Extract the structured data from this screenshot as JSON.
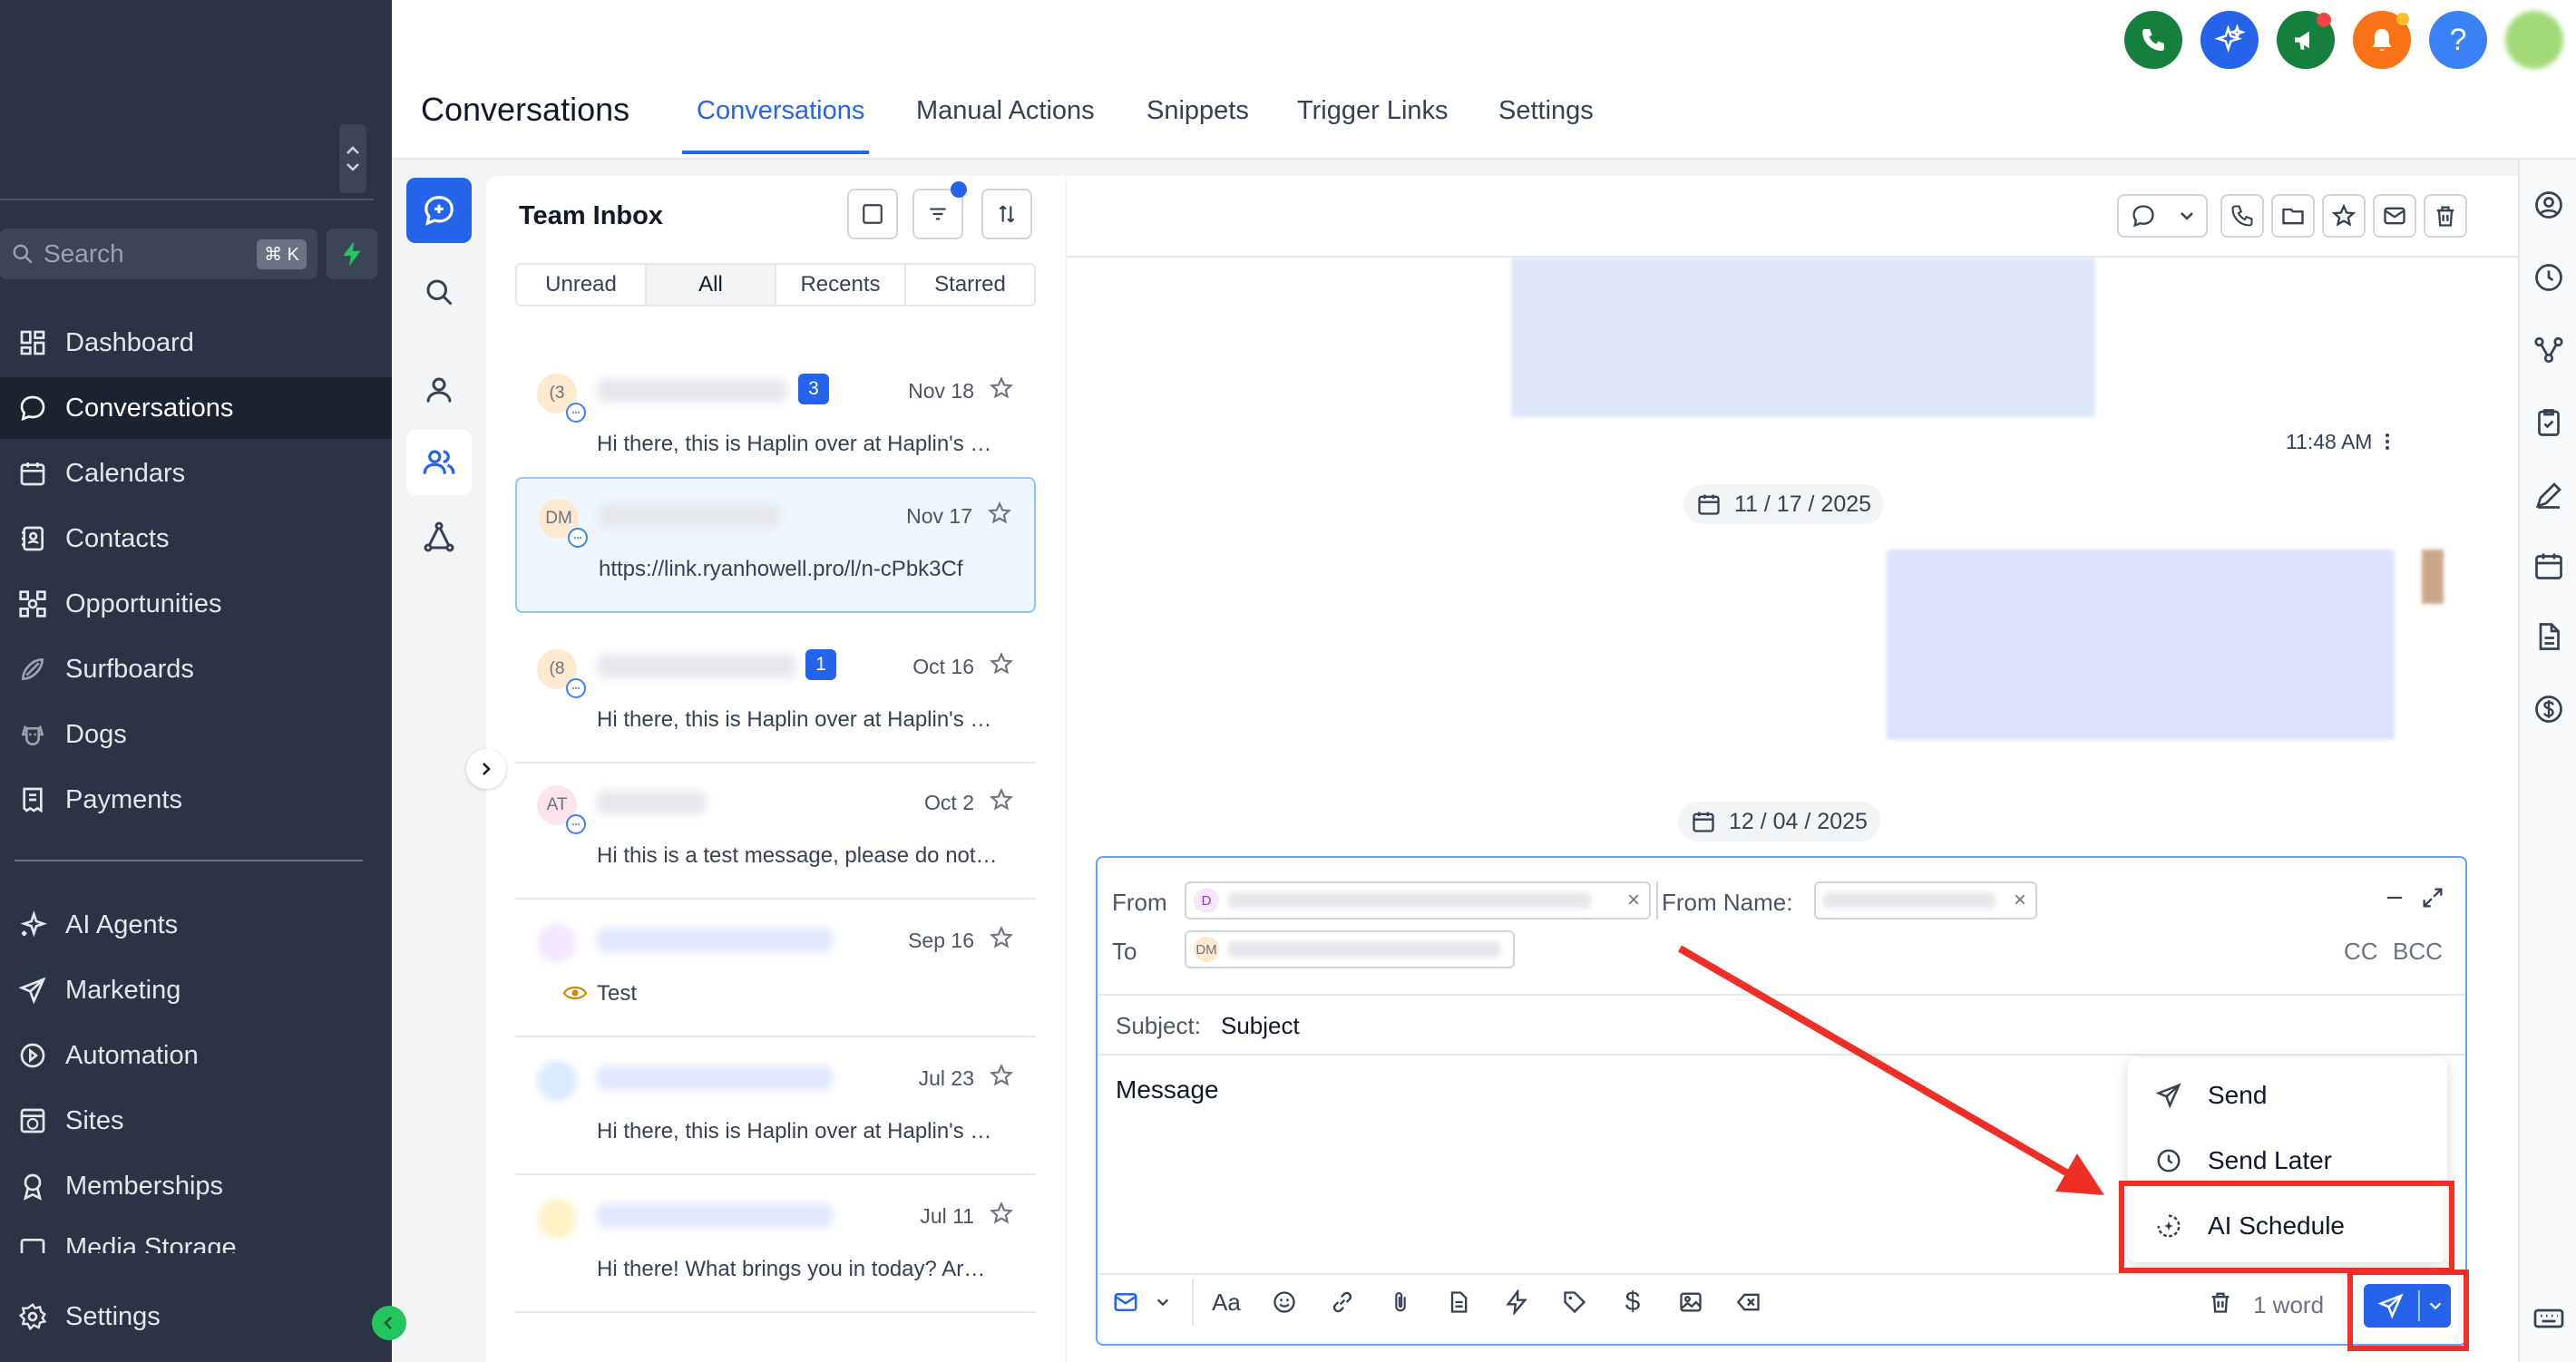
{
  "sidebar": {
    "search_placeholder": "Search",
    "search_shortcut": "⌘ K",
    "items": [
      {
        "label": "Dashboard",
        "icon": "dashboard-icon"
      },
      {
        "label": "Conversations",
        "icon": "chat-icon",
        "active": true
      },
      {
        "label": "Calendars",
        "icon": "calendar-icon"
      },
      {
        "label": "Contacts",
        "icon": "contacts-icon"
      },
      {
        "label": "Opportunities",
        "icon": "opportunities-icon"
      },
      {
        "label": "Surfboards",
        "icon": "surfboard-icon"
      },
      {
        "label": "Dogs",
        "icon": "dog-icon"
      },
      {
        "label": "Payments",
        "icon": "receipt-icon"
      },
      {
        "label": "AI Agents",
        "icon": "sparkle-icon"
      },
      {
        "label": "Marketing",
        "icon": "send-icon"
      },
      {
        "label": "Automation",
        "icon": "automation-icon"
      },
      {
        "label": "Sites",
        "icon": "globe-icon"
      },
      {
        "label": "Memberships",
        "icon": "badge-icon"
      },
      {
        "label": "Media Storage",
        "icon": "media-icon"
      }
    ],
    "settings_label": "Settings"
  },
  "header": {
    "title": "Conversations",
    "tabs": [
      "Conversations",
      "Manual Actions",
      "Snippets",
      "Trigger Links",
      "Settings"
    ],
    "active_tab": "Conversations",
    "colors": {
      "phone": "#15803d",
      "ai": "#2563eb",
      "announce": "#15803d",
      "bell": "#f97316",
      "help": "#3b82f6"
    }
  },
  "inbox": {
    "title": "Team Inbox",
    "filters": [
      "Unread",
      "All",
      "Recents",
      "Starred"
    ],
    "active_filter": "All",
    "conversations": [
      {
        "avatar": "(3",
        "badge": "3",
        "date": "Nov 18",
        "preview": "Hi there, this is Haplin over at Haplin's …"
      },
      {
        "avatar": "DM",
        "badge": "",
        "date": "Nov 17",
        "preview": "https://link.ryanhowell.pro/l/n-cPbk3Cf"
      },
      {
        "avatar": "(8",
        "badge": "1",
        "date": "Oct 16",
        "preview": "Hi there, this is Haplin over at Haplin's …"
      },
      {
        "avatar": "AT",
        "badge": "",
        "date": "Oct 2",
        "preview": "Hi this is a test message, please do not…"
      },
      {
        "avatar": "",
        "badge": "",
        "date": "Sep 16",
        "preview": "Test"
      },
      {
        "avatar": "",
        "badge": "",
        "date": "Jul 23",
        "preview": "Hi there, this is Haplin over at Haplin's …"
      },
      {
        "avatar": "",
        "badge": "",
        "date": "Jul 11",
        "preview": "Hi there! What brings you in today? Ar…"
      }
    ]
  },
  "chat": {
    "message_time": "11:48 AM",
    "date_1": "11 / 17 / 2025",
    "date_2": "12 / 04 / 2025"
  },
  "composer": {
    "from_label": "From",
    "to_label": "To",
    "from_name_label": "From Name:",
    "from_avatar": "D",
    "to_avatar": "DM",
    "cc": "CC",
    "bcc": "BCC",
    "subject_label": "Subject:",
    "subject_value": "Subject",
    "message_placeholder": "Message",
    "word_count": "1 word"
  },
  "send_menu": {
    "items": [
      "Send",
      "Send Later",
      "AI Schedule"
    ],
    "highlighted": "AI Schedule",
    "highlight_color": "#ef2f25"
  }
}
